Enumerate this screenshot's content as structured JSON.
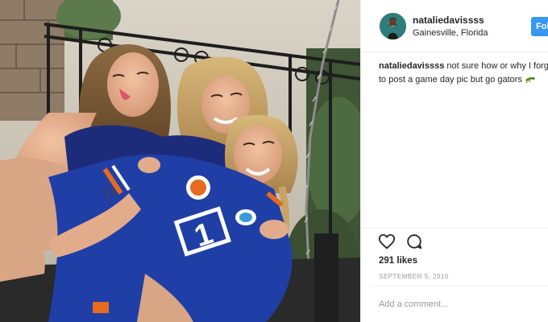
{
  "post": {
    "username": "nataliedavissss",
    "location": "Gainesville, Florida",
    "follow_label": "Follow",
    "caption_line1": "not sure how or why I forgot",
    "caption_line2": "to post a game day pic but go gators",
    "caption_emoji": "gator-emoji",
    "likes": "291 likes",
    "date": "SEPTEMBER 5, 2016",
    "comment_placeholder": "Add a comment..."
  },
  "photo": {
    "jersey_number": "1",
    "colors": {
      "jersey": "#1f3fa6",
      "accent_orange": "#e66a1f",
      "follow": "#3897f0"
    }
  },
  "icons": {
    "like": "heart-icon",
    "comment": "comment-icon"
  }
}
